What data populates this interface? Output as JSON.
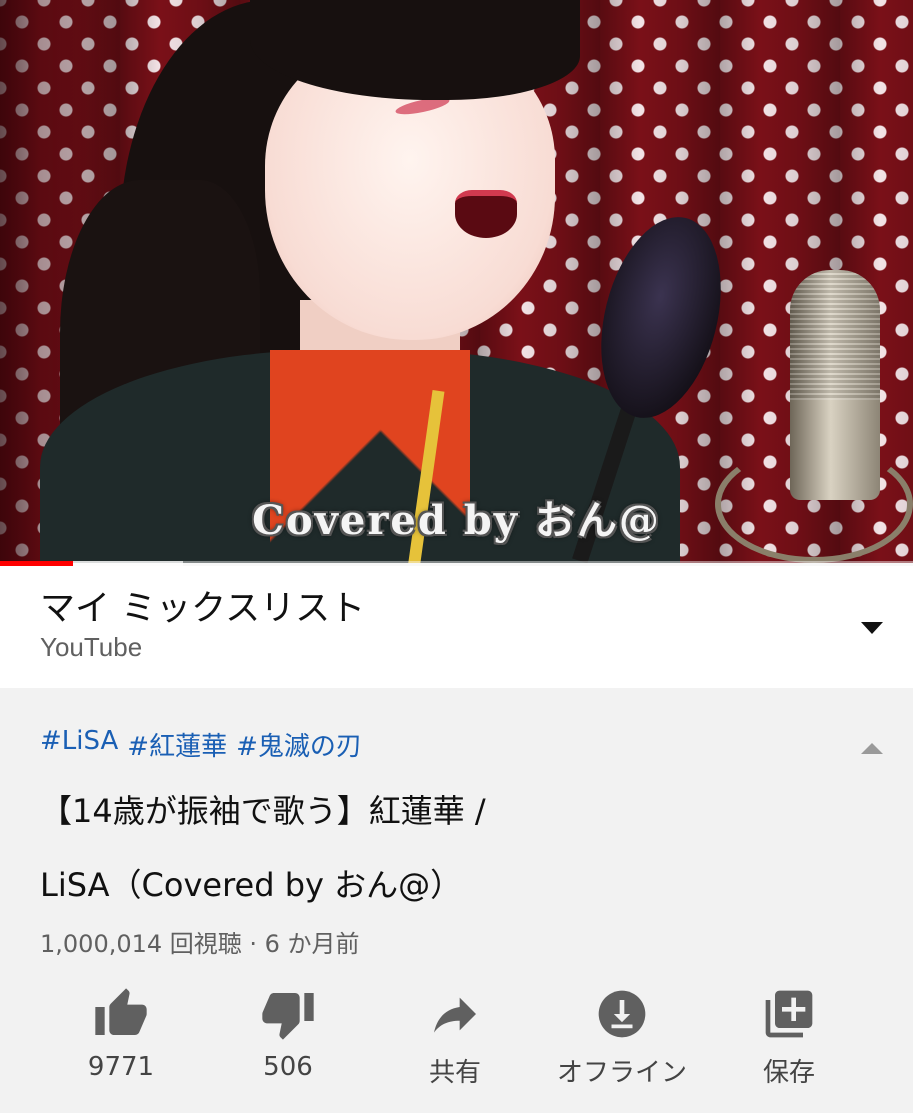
{
  "player": {
    "caption": "Covered by おん@",
    "progress_played_fraction": 0.08,
    "progress_buffered_fraction": 0.2
  },
  "mix": {
    "title": "マイ ミックスリスト",
    "source": "YouTube",
    "expand_icon": "chevron-down-icon"
  },
  "video": {
    "hashtags": [
      "#LiSA",
      "#紅蓮華",
      "#鬼滅の刃"
    ],
    "title_line1": "【14歳が振袖で歌う】紅蓮華 /",
    "title_line2": "LiSA（Covered by おん@）",
    "meta": "1,000,014 回視聴 · 6 か月前",
    "collapse_icon": "chevron-up-icon"
  },
  "actions": {
    "like": {
      "label": "9771",
      "icon": "thumbs-up-icon"
    },
    "dislike": {
      "label": "506",
      "icon": "thumbs-down-icon"
    },
    "share": {
      "label": "共有",
      "icon": "share-icon"
    },
    "offline": {
      "label": "オフライン",
      "icon": "download-icon"
    },
    "save": {
      "label": "保存",
      "icon": "add-to-playlist-icon"
    }
  },
  "colors": {
    "accent_red": "#ff0000",
    "link_blue": "#1a5fb4",
    "icon_gray": "#606060"
  }
}
